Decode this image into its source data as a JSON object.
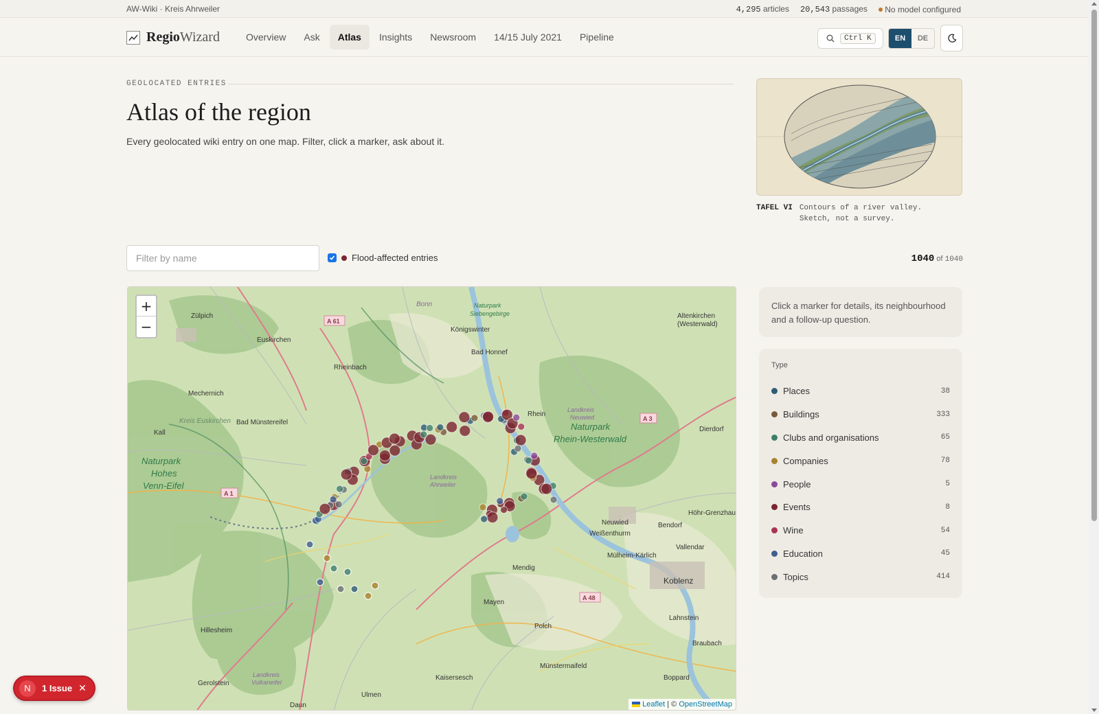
{
  "topstrip": {
    "site": "AW-Wiki · Kreis Ahrweiler",
    "articles_count": "4,295",
    "articles_label": "articles",
    "passages_count": "20,543",
    "passages_label": "passages",
    "model_status": "No model configured",
    "model_status_color": "#c07a2c"
  },
  "brand": {
    "name_bold": "Regio",
    "name_light": "Wizard",
    "icon": "chart-line-icon"
  },
  "nav": {
    "links": [
      "Overview",
      "Ask",
      "Atlas",
      "Insights",
      "Newsroom",
      "14/15 July 2021",
      "Pipeline"
    ],
    "active": "Atlas",
    "search_shortcut": "Ctrl K",
    "lang": [
      "EN",
      "DE"
    ],
    "lang_active": "EN",
    "theme_icon": "moon-icon"
  },
  "header": {
    "eyebrow": "GEOLOCATED ENTRIES",
    "title": "Atlas of the region",
    "lede": "Every geolocated wiki entry on one map. Filter, click a marker, ask about it."
  },
  "plate": {
    "label": "TAFEL VI",
    "caption_line1": "Contours of a river valley.",
    "caption_line2": "Sketch, not a survey."
  },
  "filters": {
    "name_placeholder": "Filter by name",
    "flood_label": "Flood-affected entries",
    "flood_checked": true,
    "flood_color": "#7a2530",
    "shown": "1040",
    "of_label": "of",
    "total": "1040"
  },
  "map": {
    "zoom_in": "+",
    "zoom_out": "−",
    "attribution_leaflet": "Leaflet",
    "attribution_sep": " | © ",
    "attribution_osm": "OpenStreetMap",
    "places": [
      "Zülpich",
      "Euskirchen",
      "Bonn",
      "Königswinter",
      "Bad Honnef",
      "Rheinbach",
      "Mechernich",
      "Bad Münstereifel",
      "Kall",
      "Naturpark Hohes Venn-Eifel",
      "Naturpark Siebengebirge",
      "Naturpark Rhein-Westerwald",
      "Landkreis Neuwied",
      "Landkreis Ahrweiler",
      "Kreis Euskirchen",
      "Altenkirchen (Westerwald)",
      "Dierdorf",
      "Neuwied",
      "Weißenthurm",
      "Bendorf",
      "Höhr-Grenzhausen",
      "Vallendar",
      "Mülheim-Kärlich",
      "Koblenz",
      "Mendig",
      "Mayen",
      "Polch",
      "Lahnstein",
      "Braubach",
      "Münstermaifeld",
      "Hillesheim",
      "Gerolstein",
      "Landkreis Vulkaneifel",
      "Kaisersesch",
      "Ulmen",
      "Daun",
      "Boppard",
      "Rhein",
      "A 61",
      "A 3",
      "A 1",
      "A 48"
    ]
  },
  "hint": "Click a marker for details, its neighbourhood and a follow-up question.",
  "legend": {
    "title": "Type",
    "items": [
      {
        "label": "Places",
        "count": "38",
        "color": "#2e5d74"
      },
      {
        "label": "Buildings",
        "count": "333",
        "color": "#7a5a3a"
      },
      {
        "label": "Clubs and organisations",
        "count": "65",
        "color": "#3f7f6a"
      },
      {
        "label": "Companies",
        "count": "78",
        "color": "#a8822e"
      },
      {
        "label": "People",
        "count": "5",
        "color": "#8b4a9a"
      },
      {
        "label": "Events",
        "count": "8",
        "color": "#7a2530"
      },
      {
        "label": "Wine",
        "count": "54",
        "color": "#a83552"
      },
      {
        "label": "Education",
        "count": "45",
        "color": "#3f5f8f"
      },
      {
        "label": "Topics",
        "count": "414",
        "color": "#6b6f73"
      }
    ]
  },
  "issue_badge": {
    "letter": "N",
    "label": "1 Issue"
  }
}
